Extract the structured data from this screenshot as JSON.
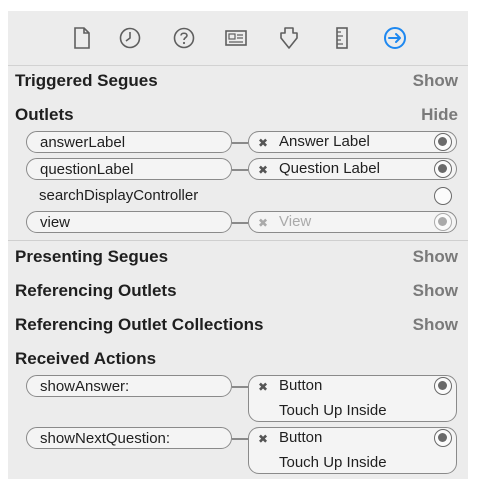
{
  "toolbar": {
    "icons": [
      "file-inspector-icon",
      "history-inspector-icon",
      "quick-help-icon",
      "identity-inspector-icon",
      "attributes-inspector-icon",
      "size-inspector-icon",
      "connections-inspector-icon"
    ],
    "active_color": "#1e88f0"
  },
  "sections": {
    "triggered_segues": {
      "title": "Triggered Segues",
      "action": "Show"
    },
    "outlets": {
      "title": "Outlets",
      "action": "Hide"
    },
    "presenting_segues": {
      "title": "Presenting Segues",
      "action": "Show"
    },
    "referencing_outlets": {
      "title": "Referencing Outlets",
      "action": "Show"
    },
    "referencing_outlet_collections": {
      "title": "Referencing Outlet Collections",
      "action": "Show"
    },
    "received_actions": {
      "title": "Received Actions"
    }
  },
  "outlets": [
    {
      "name": "answerLabel",
      "target": "Answer Label"
    },
    {
      "name": "questionLabel",
      "target": "Question Label"
    },
    {
      "name": "searchDisplayController"
    },
    {
      "name": "view",
      "target": "View"
    }
  ],
  "actions": [
    {
      "name": "showAnswer:",
      "target": "Button",
      "event": "Touch Up Inside"
    },
    {
      "name": "showNextQuestion:",
      "target": "Button",
      "event": "Touch Up Inside"
    }
  ],
  "glyphs": {
    "remove": "✖"
  }
}
